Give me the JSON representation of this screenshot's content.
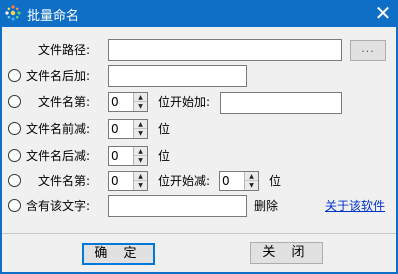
{
  "window": {
    "title": "批量命名",
    "close_glyph": "✕",
    "icon": "app-icon"
  },
  "form": {
    "path_label": "文件路径:",
    "path_value": "",
    "browse_label": "...",
    "suffix_add_label": "文件名后加:",
    "suffix_add_value": "",
    "insert_prefix": "文件名第:",
    "insert_pos": "0",
    "insert_suffix": "位开始加:",
    "insert_value": "",
    "trim_front_label": "文件名前减:",
    "trim_front_value": "0",
    "trim_front_unit": "位",
    "trim_back_label": "文件名后减:",
    "trim_back_value": "0",
    "trim_back_unit": "位",
    "cut_prefix": "文件名第:",
    "cut_pos": "0",
    "cut_mid": "位开始减:",
    "cut_count": "0",
    "cut_unit": "位",
    "contains_label": "含有该文字:",
    "contains_value": "",
    "contains_suffix": "删除",
    "about_link": "关于该软件"
  },
  "buttons": {
    "ok": "确 定",
    "close": "关 闭"
  },
  "colors": {
    "titlebar": "#0f6fc6",
    "link": "#0033cc",
    "default_button_border": "#0078d7"
  }
}
